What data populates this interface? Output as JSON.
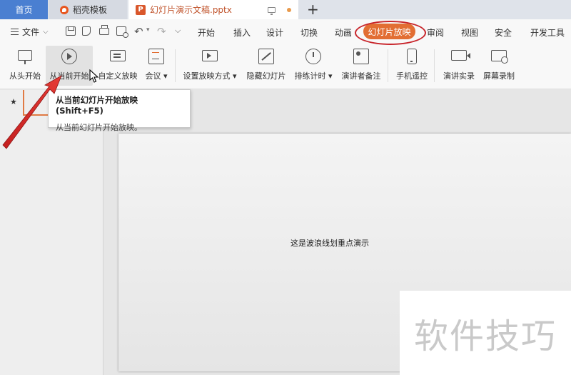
{
  "tabs": {
    "home": "首页",
    "templates": "稻壳模板",
    "document": "幻灯片演示文稿.pptx",
    "new_tab": "+"
  },
  "menu": {
    "file": "文件",
    "items": [
      "开始",
      "插入",
      "设计",
      "切换",
      "动画",
      "幻灯片放映",
      "审阅",
      "视图",
      "安全",
      "开发工具"
    ],
    "active_index": 5
  },
  "ribbon": {
    "buttons": [
      {
        "label": "从头开始",
        "icon": "monitor-play-icon"
      },
      {
        "label": "从当前开始",
        "icon": "play-circle-icon"
      },
      {
        "label": "自定义放映",
        "icon": "custom-slideshow-icon"
      },
      {
        "label": "会议",
        "icon": "meeting-icon"
      },
      {
        "label": "设置放映方式",
        "icon": "slideshow-settings-icon"
      },
      {
        "label": "隐藏幻灯片",
        "icon": "hide-slide-icon"
      },
      {
        "label": "排练计时",
        "icon": "timer-icon"
      },
      {
        "label": "演讲者备注",
        "icon": "speaker-notes-icon"
      },
      {
        "label": "手机遥控",
        "icon": "phone-remote-icon"
      },
      {
        "label": "演讲实录",
        "icon": "video-record-icon"
      },
      {
        "label": "屏幕录制",
        "icon": "screen-record-icon"
      }
    ]
  },
  "tooltip": {
    "title": "从当前幻灯片开始放映 (Shift+F5)",
    "description": "从当前幻灯片开始放映。"
  },
  "slide": {
    "text": "这是波浪线划重点演示"
  },
  "watermark": "软件技巧",
  "colors": {
    "accent": "#e26e33",
    "home_tab": "#4a7fd1",
    "annotation": "#c8252b"
  }
}
